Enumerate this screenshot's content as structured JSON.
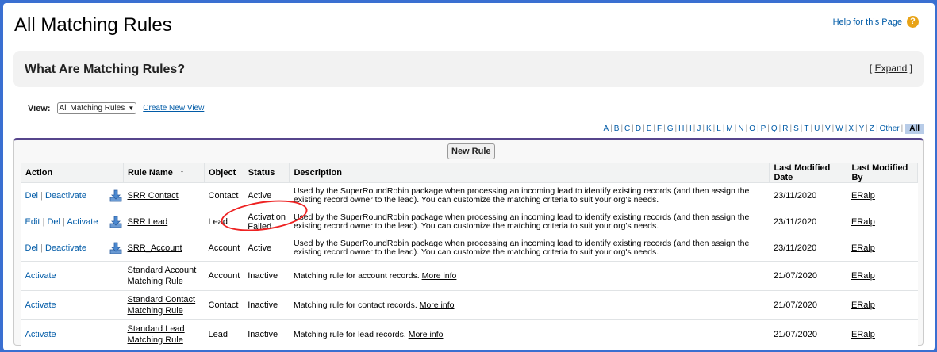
{
  "page": {
    "title": "All Matching Rules",
    "help_label": "Help for this Page",
    "help_icon": "?"
  },
  "info": {
    "title": "What Are Matching Rules?",
    "expand_open": "[",
    "expand_label": "Expand",
    "expand_close": "]"
  },
  "view": {
    "label": "View:",
    "selected": "All Matching Rules",
    "create_link": "Create New View"
  },
  "alphabet": [
    "A",
    "B",
    "C",
    "D",
    "E",
    "F",
    "G",
    "H",
    "I",
    "J",
    "K",
    "L",
    "M",
    "N",
    "O",
    "P",
    "Q",
    "R",
    "S",
    "T",
    "U",
    "V",
    "W",
    "X",
    "Y",
    "Z",
    "Other"
  ],
  "alphabet_all": "All",
  "toolbar": {
    "new_rule": "New Rule"
  },
  "columns": {
    "action": "Action",
    "rule_name": "Rule Name",
    "sort_arrow": "↑",
    "object": "Object",
    "status": "Status",
    "description": "Description",
    "last_modified_date": "Last Modified Date",
    "last_modified_by": "Last Modified By"
  },
  "rows": [
    {
      "actions": [
        "Del",
        "Deactivate"
      ],
      "name": "SRR Contact",
      "object": "Contact",
      "status": "Active",
      "description": "Used by the SuperRoundRobin package when processing an incoming lead to identify existing records (and then assign the existing record owner to the lead). You can customize the matching criteria to suit your org's needs.",
      "more_info": "",
      "date": "23/11/2020",
      "by": "ERalp",
      "icon": true
    },
    {
      "actions": [
        "Edit",
        "Del",
        "Activate"
      ],
      "name": "SRR Lead",
      "object": "Lead",
      "status": "Activation Failed",
      "description": "Used by the SuperRoundRobin package when processing an incoming lead to identify existing records (and then assign the existing record owner to the lead). You can customize the matching criteria to suit your org's needs.",
      "more_info": "",
      "date": "23/11/2020",
      "by": "ERalp",
      "icon": true
    },
    {
      "actions": [
        "Del",
        "Deactivate"
      ],
      "name": "SRR_Account",
      "object": "Account",
      "status": "Active",
      "description": "Used by the SuperRoundRobin package when processing an incoming lead to identify existing records (and then assign the existing record owner to the lead). You can customize the matching criteria to suit your org's needs.",
      "more_info": "",
      "date": "23/11/2020",
      "by": "ERalp",
      "icon": true
    },
    {
      "actions": [
        "Activate"
      ],
      "name": "Standard Account Matching Rule",
      "object": "Account",
      "status": "Inactive",
      "description": "Matching rule for account records.",
      "more_info": "More info",
      "date": "21/07/2020",
      "by": "ERalp",
      "icon": false
    },
    {
      "actions": [
        "Activate"
      ],
      "name": "Standard Contact Matching Rule",
      "object": "Contact",
      "status": "Inactive",
      "description": "Matching rule for contact records.",
      "more_info": "More info",
      "date": "21/07/2020",
      "by": "ERalp",
      "icon": false
    },
    {
      "actions": [
        "Activate"
      ],
      "name": "Standard Lead Matching Rule",
      "object": "Lead",
      "status": "Inactive",
      "description": "Matching rule for lead records.",
      "more_info": "More info",
      "date": "21/07/2020",
      "by": "ERalp",
      "icon": false
    }
  ],
  "colors": {
    "link": "#015ba7",
    "header_bar": "#56458c",
    "annotation": "#e22222"
  }
}
